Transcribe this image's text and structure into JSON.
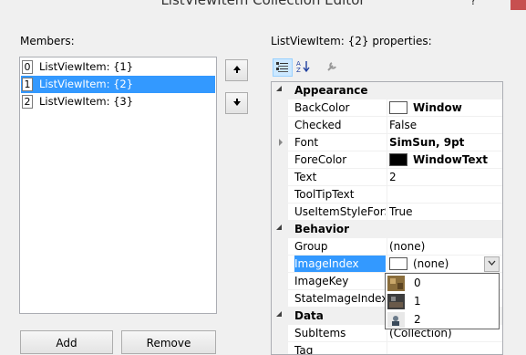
{
  "window": {
    "title": "ListViewItem Collection Editor",
    "help_glyph": "?"
  },
  "members": {
    "label": "Members:",
    "items": [
      {
        "index": "0",
        "label": "ListViewItem: {1}"
      },
      {
        "index": "1",
        "label": "ListViewItem: {2}",
        "selected": true
      },
      {
        "index": "2",
        "label": "ListViewItem: {3}"
      }
    ],
    "move_up_icon": "arrow-up-icon",
    "move_down_icon": "arrow-down-icon"
  },
  "buttons": {
    "add": "Add",
    "remove": "Remove"
  },
  "properties": {
    "label": "ListViewItem: {2} properties:",
    "toolbar": {
      "categorized_icon": "categorized-icon",
      "alphabetical_icon": "alphabetical-icon",
      "property_pages_icon": "wrench-icon"
    },
    "rows": [
      {
        "kind": "category",
        "name": "Appearance"
      },
      {
        "name": "BackColor",
        "value": "Window",
        "swatch": "#ffffff",
        "bold": true
      },
      {
        "name": "Checked",
        "value": "False"
      },
      {
        "name": "Font",
        "value": "SimSun, 9pt",
        "bold": true,
        "expandable": true
      },
      {
        "name": "ForeColor",
        "value": "WindowText",
        "swatch": "#000000",
        "bold": true
      },
      {
        "name": "Text",
        "value": "2"
      },
      {
        "name": "ToolTipText",
        "value": ""
      },
      {
        "name": "UseItemStyleForSubItems",
        "value": "True"
      },
      {
        "kind": "category",
        "name": "Behavior"
      },
      {
        "name": "Group",
        "value": "(none)"
      },
      {
        "name": "ImageIndex",
        "value": "(none)",
        "swatch": "#ffffff",
        "selected": true
      },
      {
        "name": "ImageKey",
        "value": ""
      },
      {
        "name": "StateImageIndex",
        "value": ""
      },
      {
        "kind": "category",
        "name": "Data"
      },
      {
        "name": "SubItems",
        "value": "(Collection)"
      },
      {
        "name": "Tag",
        "value": ""
      }
    ]
  },
  "image_dropdown": {
    "options": [
      {
        "label": "0",
        "thumb_color": "#8a6d3b"
      },
      {
        "label": "1",
        "thumb_color": "#3d3d3d"
      },
      {
        "label": "2",
        "thumb_color": "#6a7a8a"
      }
    ]
  }
}
